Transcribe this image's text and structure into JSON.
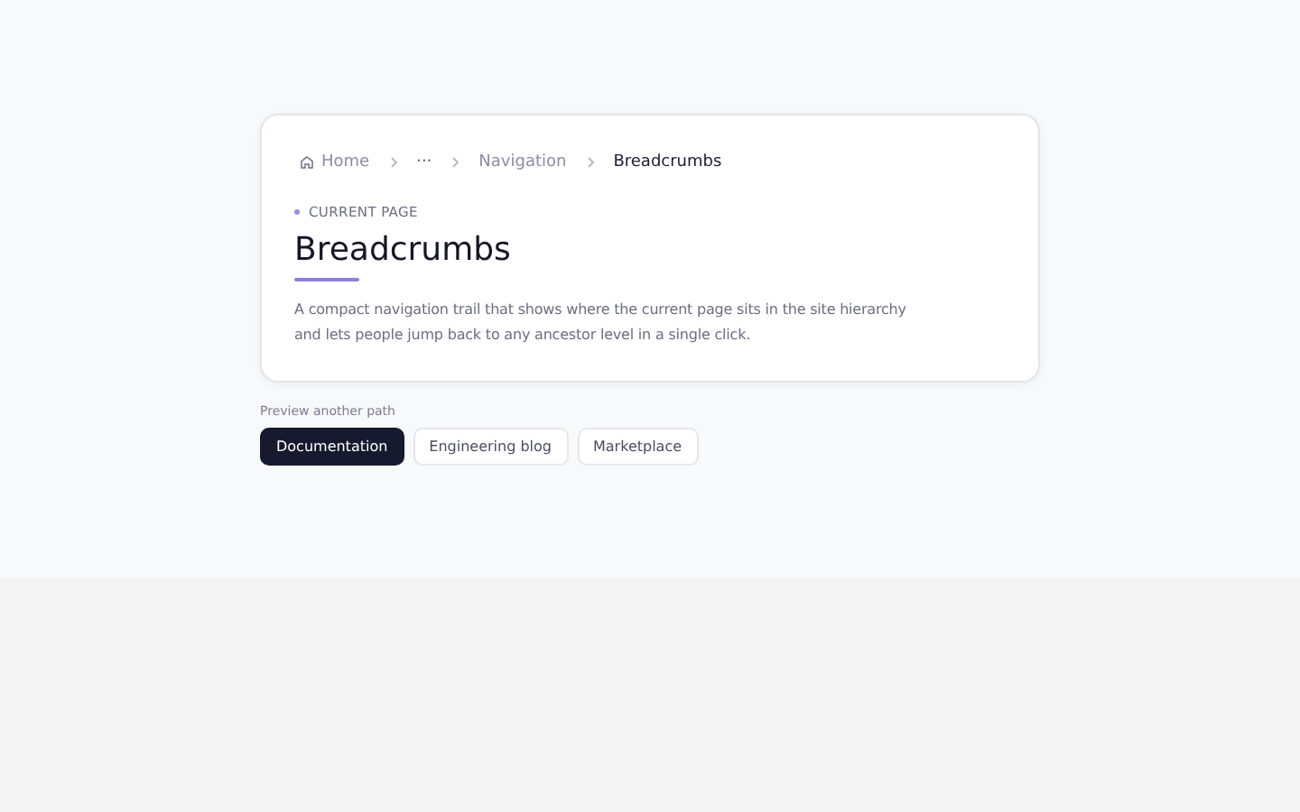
{
  "breadcrumbs": [
    {
      "kind": "home",
      "label": "Home"
    },
    {
      "kind": "ellipsis",
      "label": "···"
    },
    {
      "kind": "link",
      "label": "Navigation"
    },
    {
      "kind": "current",
      "label": "Breadcrumbs"
    }
  ],
  "eyebrow": "CURRENT PAGE",
  "title": "Breadcrumbs",
  "description": "A compact navigation trail that shows where the current page sits in the site hierarchy and lets people jump back to any ancestor level in a single click.",
  "preview": {
    "label": "Preview another path",
    "options": [
      {
        "label": "Documentation",
        "selected": true
      },
      {
        "label": "Engineering blog",
        "selected": false
      },
      {
        "label": "Marketplace",
        "selected": false
      }
    ]
  }
}
